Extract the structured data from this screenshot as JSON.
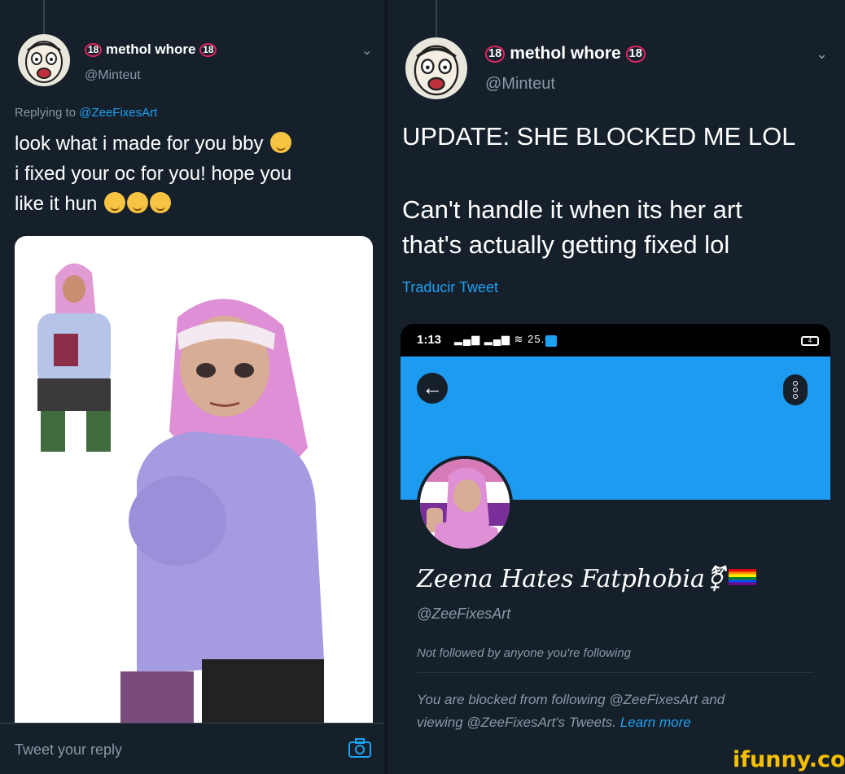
{
  "left_tweet": {
    "author": {
      "name": "methol whore",
      "badge": "18",
      "handle": "@Minteut"
    },
    "replying_prefix": "Replying to",
    "replying_to": "@ZeeFixesArt",
    "body_line1": "look what i made for you bby",
    "body_line2": "i fixed your oc for you! hope you",
    "body_line3": "like it hun",
    "reply_placeholder": "Tweet your reply"
  },
  "right_tweet": {
    "author": {
      "name": "methol whore",
      "badge": "18",
      "handle": "@Minteut"
    },
    "body_line1": "UPDATE: SHE BLOCKED ME LOL",
    "body_line2": "Can't handle it when its her art",
    "body_line3": "that's actually getting fixed lol",
    "translate": "Traducir Tweet"
  },
  "phone_screenshot": {
    "status_time": "1:13",
    "status_speed": "25.0",
    "battery": "4",
    "profile_name": "Zeena Hates Fatphobia",
    "profile_symbol": "⚧",
    "profile_handle": "@ZeeFixesArt",
    "followed_note": "Not followed by anyone you're following",
    "blocked_line1": "You are blocked from following @ZeeFixesArt and",
    "blocked_line2": "viewing @ZeeFixesArt's Tweets.",
    "learn_more": "Learn more"
  },
  "watermark": "ifunny.co",
  "colors": {
    "background": "#15202b",
    "accent": "#1da1f2",
    "muted": "#8899a6",
    "banner": "#1d9bf0",
    "badge": "#e0245e"
  }
}
